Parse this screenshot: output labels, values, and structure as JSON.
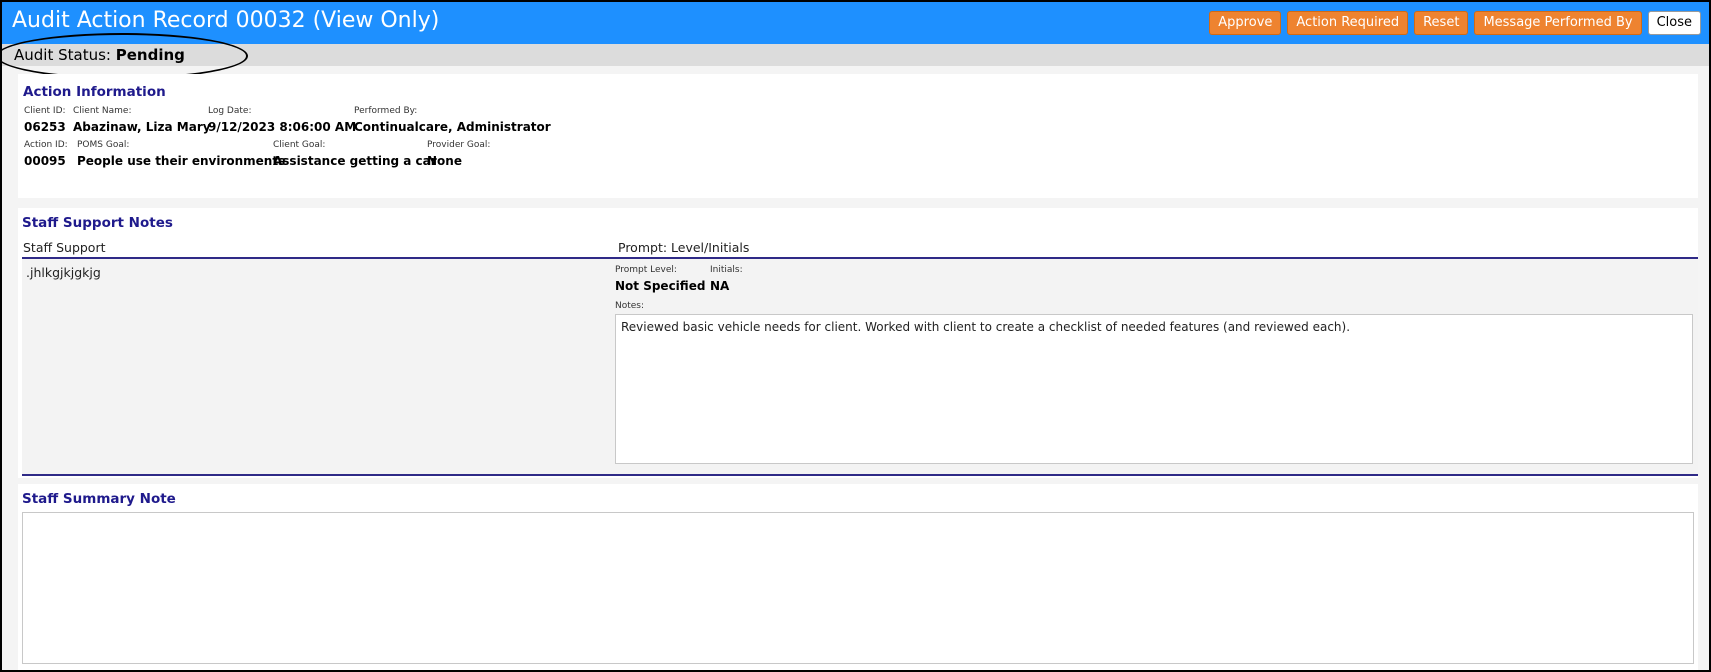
{
  "window": {
    "title": "Audit Action Record 00032 (View Only)"
  },
  "toolbar": {
    "approve_label": "Approve",
    "action_required_label": "Action Required",
    "reset_label": "Reset",
    "message_label": "Message Performed By",
    "close_label": "Close"
  },
  "status": {
    "label": "Audit Status:",
    "value": "Pending"
  },
  "action_info": {
    "title": "Action Information",
    "client_id_label": "Client ID:",
    "client_id": "06253",
    "client_name_label": "Client Name:",
    "client_name": "Abazinaw, Liza Mary",
    "log_date_label": "Log Date:",
    "log_date": "9/12/2023 8:06:00 AM",
    "performed_by_label": "Performed By:",
    "performed_by": "Continualcare, Administrator",
    "action_id_label": "Action ID:",
    "action_id": "00095",
    "poms_goal_label": "POMS Goal:",
    "poms_goal": "People use their environments",
    "client_goal_label": "Client Goal:",
    "client_goal": "Assistance getting a car",
    "provider_goal_label": "Provider Goal:",
    "provider_goal": "None"
  },
  "staff_support": {
    "title": "Staff Support Notes",
    "col_support": "Staff Support",
    "col_prompt": "Prompt: Level/Initials",
    "support_text": ".jhlkgjkjgkjg",
    "prompt_level_label": "Prompt Level:",
    "prompt_level": "Not Specified",
    "initials_label": "Initials:",
    "initials": "NA",
    "notes_label": "Notes:",
    "notes": "Reviewed basic vehicle needs for client. Worked with client to create a checklist of needed features (and reviewed each)."
  },
  "summary": {
    "title": "Staff Summary Note",
    "text": ""
  },
  "colors": {
    "titlebar": "#1e90ff",
    "button_orange": "#ee8330",
    "section_title": "#1f1a8c"
  }
}
